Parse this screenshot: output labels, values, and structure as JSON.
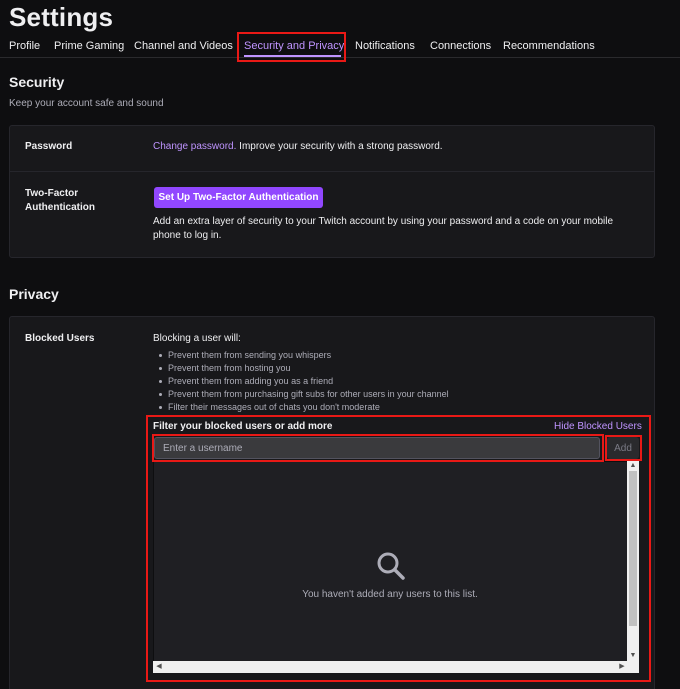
{
  "page": {
    "title": "Settings"
  },
  "tabs": [
    {
      "label": "Profile"
    },
    {
      "label": "Prime Gaming"
    },
    {
      "label": "Channel and Videos"
    },
    {
      "label": "Security and Privacy"
    },
    {
      "label": "Notifications"
    },
    {
      "label": "Connections"
    },
    {
      "label": "Recommendations"
    }
  ],
  "security": {
    "title": "Security",
    "subtitle": "Keep your account safe and sound",
    "password": {
      "label": "Password",
      "link": "Change password.",
      "text": " Improve your security with a strong password."
    },
    "two_factor": {
      "label_line1": "Two-Factor",
      "label_line2": "Authentication",
      "button": "Set Up Two-Factor Authentication",
      "desc_line1": "Add an extra layer of security to your Twitch account by using your password and a code on your mobile",
      "desc_line2": "phone to log in."
    }
  },
  "privacy": {
    "title": "Privacy",
    "blocked_users": {
      "label": "Blocked Users",
      "intro": "Blocking a user will:",
      "bullets": [
        "Prevent them from sending you whispers",
        "Prevent them from hosting you",
        "Prevent them from adding you as a friend",
        "Prevent them from purchasing gift subs for other users in your channel",
        "Filter their messages out of chats you don't moderate"
      ],
      "filter_label": "Filter your blocked users or add more",
      "hide_link": "Hide Blocked Users",
      "input_placeholder": "Enter a username",
      "add_button": "Add",
      "empty_text": "You haven't added any users to this list."
    }
  },
  "colors": {
    "accent": "#9147ff",
    "link": "#bf94ff",
    "highlight": "#e91916",
    "background": "#0e0e10",
    "card": "#18181b"
  },
  "icons": {
    "empty_state": "search-icon",
    "scroll_up": "arrow-up-icon",
    "scroll_down": "arrow-down-icon",
    "scroll_left": "arrow-left-icon",
    "scroll_right": "arrow-right-icon"
  }
}
